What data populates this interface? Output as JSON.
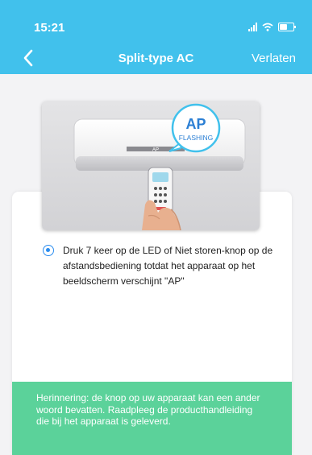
{
  "status_bar": {
    "time": "15:21",
    "battery_level": 0.55
  },
  "nav": {
    "title": "Split-type AC",
    "exit_label": "Verlaten",
    "back_icon": "chevron-left-icon"
  },
  "illustration": {
    "bubble_title": "AP",
    "bubble_subtitle": "FLASHING",
    "display_text": "AP"
  },
  "instruction": {
    "selected": true,
    "text": "Druk 7 keer op de LED of Niet storen-knop op de afstandsbediening totdat het apparaat op het beeldscherm verschijnt \"AP\""
  },
  "reminder": {
    "text": "Herinnering: de knop op uw apparaat kan een ander woord bevatten. Raadpleeg de producthandleiding die bij het apparaat is geleverd."
  },
  "colors": {
    "header": "#41c1ec",
    "accent": "#2a8cef",
    "reminder_bg": "#5bd29a",
    "background": "#f3f3f5"
  }
}
